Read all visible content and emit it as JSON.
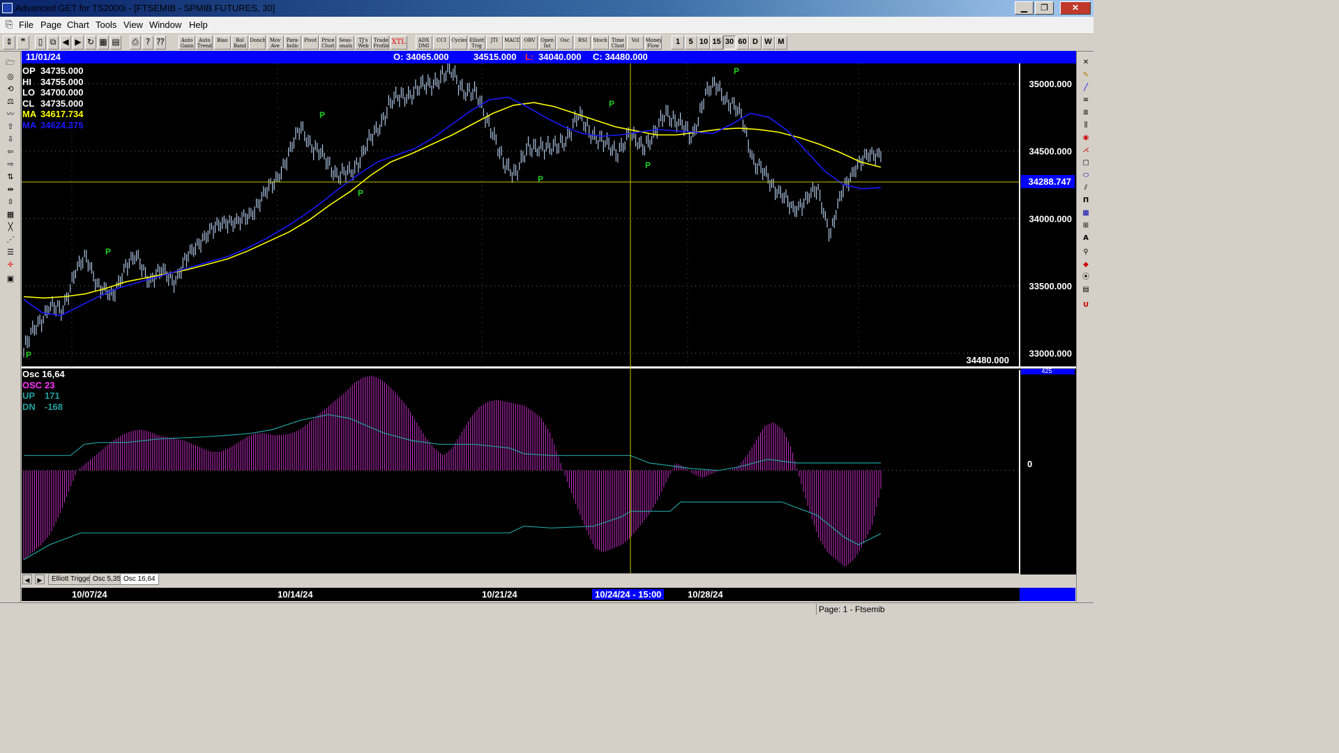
{
  "window": {
    "title": "Advanced GET for TS2000i - [FTSEMIB - SPMIB FUTURES, 30]",
    "minimize": "▁",
    "maximize": "❐",
    "close": "✕"
  },
  "menu": {
    "items": [
      "File",
      "Page",
      "Chart",
      "Tools",
      "View",
      "Window",
      "Help"
    ],
    "mdi": [
      "–",
      "❐",
      "✕"
    ]
  },
  "toolbar": {
    "studies": [
      "Auto Gann",
      "Auto Trend",
      "Bias",
      "Bol Band",
      "Donch",
      "Mov Ave",
      "Para- bolic",
      "Pivot",
      "Price Clust",
      "Seas- onals",
      "TJ's Web",
      "Trade Profile",
      "XTL",
      "ADX DMI",
      "CCI",
      "Cycles",
      "Elliott Trig",
      "JTI",
      "MACD",
      "OBV",
      "Open Int",
      "Osc",
      "RSI",
      "Stoch",
      "Time Clust",
      "Vol",
      "Money Flow"
    ],
    "intervals": [
      "1",
      "5",
      "10",
      "15",
      "30",
      "60",
      "D",
      "W",
      "M"
    ]
  },
  "header": {
    "date": "11/01/24",
    "open": "O: 34065.000",
    "high": "34515.000",
    "low_prefix": "L:",
    "low": "34040.000",
    "close": "C: 34480.000"
  },
  "price_panel": {
    "readouts": [
      {
        "label": "OP",
        "value": "34735.000",
        "color": "#ffffff"
      },
      {
        "label": "HI",
        "value": "34755.000",
        "color": "#ffffff"
      },
      {
        "label": "LO",
        "value": "34700.000",
        "color": "#ffffff"
      },
      {
        "label": "CL",
        "value": "34735.000",
        "color": "#ffffff"
      },
      {
        "label": "MA",
        "value": "34617.734",
        "color": "#ffff00"
      },
      {
        "label": "MA",
        "value": "34624.375",
        "color": "#1a1aff"
      }
    ],
    "y_ticks": [
      "35000.000",
      "34500.000",
      "34000.000",
      "33500.000",
      "33000.000"
    ],
    "cursor_price": "34288.747",
    "last_price": "34480.000",
    "pivot_label": "P"
  },
  "osc_panel": {
    "title": "Osc 16,64",
    "readouts": [
      {
        "label": "OSC",
        "value": "23",
        "color": "#ff33ff"
      },
      {
        "label": "UP",
        "value": "171",
        "color": "#20a0a0"
      },
      {
        "label": "DN",
        "value": "-168",
        "color": "#20a0a0"
      }
    ],
    "zero_label": "0",
    "top_value": "425"
  },
  "tabs": [
    "Elliott Trigger",
    "Osc 5,35",
    "Osc 16,64"
  ],
  "dates": [
    "10/07/24",
    "10/14/24",
    "10/21/24",
    "10/24/24 - 15:00",
    "10/28/24"
  ],
  "status": {
    "page": "Page: 1 - Ftsemib"
  },
  "chart_data": {
    "type": "line",
    "title": "FTSEMIB - SPMIB FUTURES, 30",
    "ylim": [
      32900,
      35150
    ],
    "x_labels": [
      "10/07/24",
      "10/14/24",
      "10/21/24",
      "10/28/24"
    ],
    "series": [
      {
        "name": "Price",
        "color": "#b0c8e8",
        "values": [
          33020,
          33200,
          33350,
          33300,
          33600,
          33700,
          33500,
          33400,
          33650,
          33700,
          33550,
          33600,
          33550,
          33700,
          33850,
          33900,
          34000,
          33950,
          34050,
          34150,
          34300,
          34450,
          34700,
          34500,
          34450,
          34300,
          34350,
          34500,
          34650,
          34850,
          34900,
          34950,
          34980,
          35050,
          35080,
          34950,
          34900,
          34700,
          34400,
          34350,
          34500,
          34550,
          34500,
          34600,
          34750,
          34650,
          34550,
          34500,
          34600,
          34550,
          34600,
          34800,
          34700,
          34600,
          34900,
          35000,
          34850,
          34750,
          34400,
          34300,
          34200,
          34050,
          34150,
          34200,
          33900,
          34200,
          34400,
          34450,
          34500
        ]
      },
      {
        "name": "MA",
        "color": "#ffff00",
        "values": [
          33420,
          33410,
          33420,
          33440,
          33480,
          33530,
          33560,
          33590,
          33620,
          33660,
          33700,
          33760,
          33830,
          33900,
          33990,
          34100,
          34200,
          34320,
          34420,
          34480,
          34550,
          34620,
          34700,
          34780,
          34840,
          34860,
          34830,
          34780,
          34730,
          34680,
          34650,
          34620,
          34620,
          34640,
          34660,
          34670,
          34660,
          34640,
          34600,
          34550,
          34490,
          34420,
          34380
        ]
      },
      {
        "name": "MA",
        "color": "#1a1aff",
        "values": [
          33400,
          33300,
          33280,
          33350,
          33420,
          33480,
          33520,
          33560,
          33600,
          33640,
          33680,
          33720,
          33780,
          33850,
          33930,
          34020,
          34120,
          34230,
          34330,
          34420,
          34470,
          34520,
          34600,
          34700,
          34800,
          34880,
          34900,
          34830,
          34750,
          34680,
          34630,
          34610,
          34620,
          34640,
          34660,
          34650,
          34640,
          34630,
          34700,
          34780,
          34750,
          34650,
          34500,
          34350,
          34250,
          34220,
          34230
        ]
      }
    ]
  },
  "osc_data": {
    "type": "bar",
    "ylim": [
      -280,
      260
    ],
    "values": [
      -240,
      -220,
      -200,
      -170,
      -120,
      -60,
      0,
      20,
      40,
      60,
      80,
      95,
      105,
      110,
      105,
      95,
      90,
      85,
      80,
      70,
      60,
      50,
      50,
      60,
      75,
      90,
      100,
      100,
      95,
      95,
      100,
      110,
      130,
      150,
      170,
      190,
      210,
      235,
      250,
      255,
      245,
      225,
      200,
      170,
      130,
      90,
      60,
      40,
      60,
      100,
      140,
      170,
      185,
      190,
      185,
      180,
      175,
      160,
      140,
      100,
      30,
      -40,
      -100,
      -160,
      -210,
      -220,
      -210,
      -200,
      -180,
      -150,
      -120,
      -80,
      -30,
      20,
      10,
      -10,
      -20,
      -10,
      0,
      0,
      10,
      40,
      80,
      120,
      130,
      110,
      60,
      -30,
      -110,
      -180,
      -220,
      -240,
      -260,
      -240,
      -200,
      -150,
      -50
    ]
  }
}
